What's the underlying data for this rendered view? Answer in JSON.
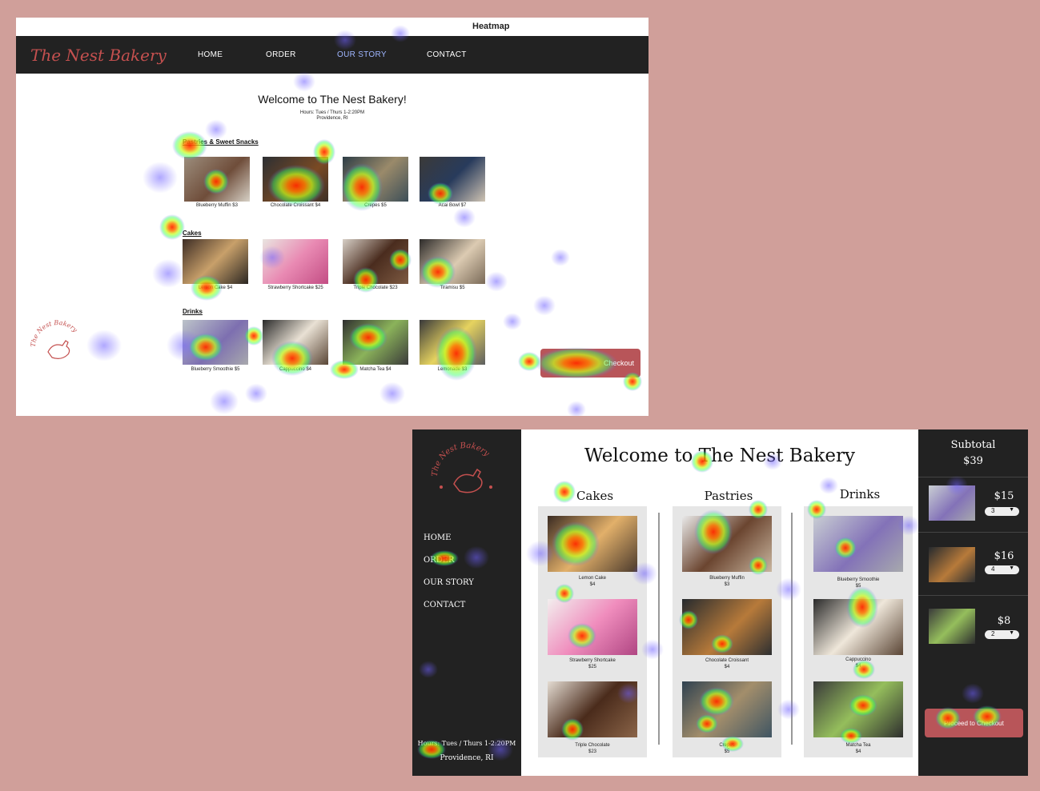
{
  "heatmap_view": {
    "title": "Heatmap",
    "brand": "The Nest Bakery",
    "nav": [
      "HOME",
      "ORDER",
      "OUR STORY",
      "CONTACT"
    ],
    "welcome": "Welcome to The Nest Bakery!",
    "hours": "Hours: Tues / Thurs 1-2:20PM",
    "location": "Providence, RI",
    "sections": [
      {
        "title": "Pastries & Sweet Snacks",
        "items": [
          "Blueberry Muffin $3",
          "Chocolate Croissant $4",
          "Crepes $5",
          "Acai Bowl $7"
        ]
      },
      {
        "title": "Cakes",
        "items": [
          "Lemon Cake $4",
          "Strawberry Shortcake $25",
          "Triple Chocolate $23",
          "Tiramisu $5"
        ]
      },
      {
        "title": "Drinks",
        "items": [
          "Blueberry Smoothie $5",
          "Cappuccino $4",
          "Matcha Tea $4",
          "Lemonade $3"
        ]
      }
    ],
    "checkout": "Checkout",
    "stamp_text": "The Nest Bakery"
  },
  "redesign_view": {
    "brand_stamp": "The Nest Bakery",
    "nav": [
      "HOME",
      "ORDER",
      "OUR STORY",
      "CONTACT"
    ],
    "title": "Welcome to The Nest Bakery",
    "hours": "Hours: Tues / Thurs 1-2:20PM",
    "location": "Providence, RI",
    "columns": [
      {
        "title": "Cakes",
        "items": [
          {
            "name": "Lemon Cake",
            "price": "$4"
          },
          {
            "name": "Strawberry Shortcake",
            "price": "$25"
          },
          {
            "name": "Triple Chocolate",
            "price": "$23"
          }
        ]
      },
      {
        "title": "Pastries",
        "items": [
          {
            "name": "Blueberry Muffin",
            "price": "$3"
          },
          {
            "name": "Chocolate Croissant",
            "price": "$4"
          },
          {
            "name": "Crepes",
            "price": "$5"
          }
        ]
      },
      {
        "title": "Drinks",
        "items": [
          {
            "name": "Blueberry Smoothie",
            "price": "$5"
          },
          {
            "name": "Cappuccino",
            "price": "$4"
          },
          {
            "name": "Matcha Tea",
            "price": "$4"
          }
        ]
      }
    ],
    "cart": {
      "subtotal_label": "Subtotal",
      "subtotal": "$39",
      "items": [
        {
          "price": "$15",
          "qty": "3"
        },
        {
          "price": "$16",
          "qty": "4"
        },
        {
          "price": "$8",
          "qty": "2"
        }
      ],
      "proceed": "Proceed to Checkout"
    }
  },
  "colors": {
    "background": "#d09f9a",
    "nav": "#222222",
    "accent": "#c4504f",
    "button": "#b85559"
  }
}
